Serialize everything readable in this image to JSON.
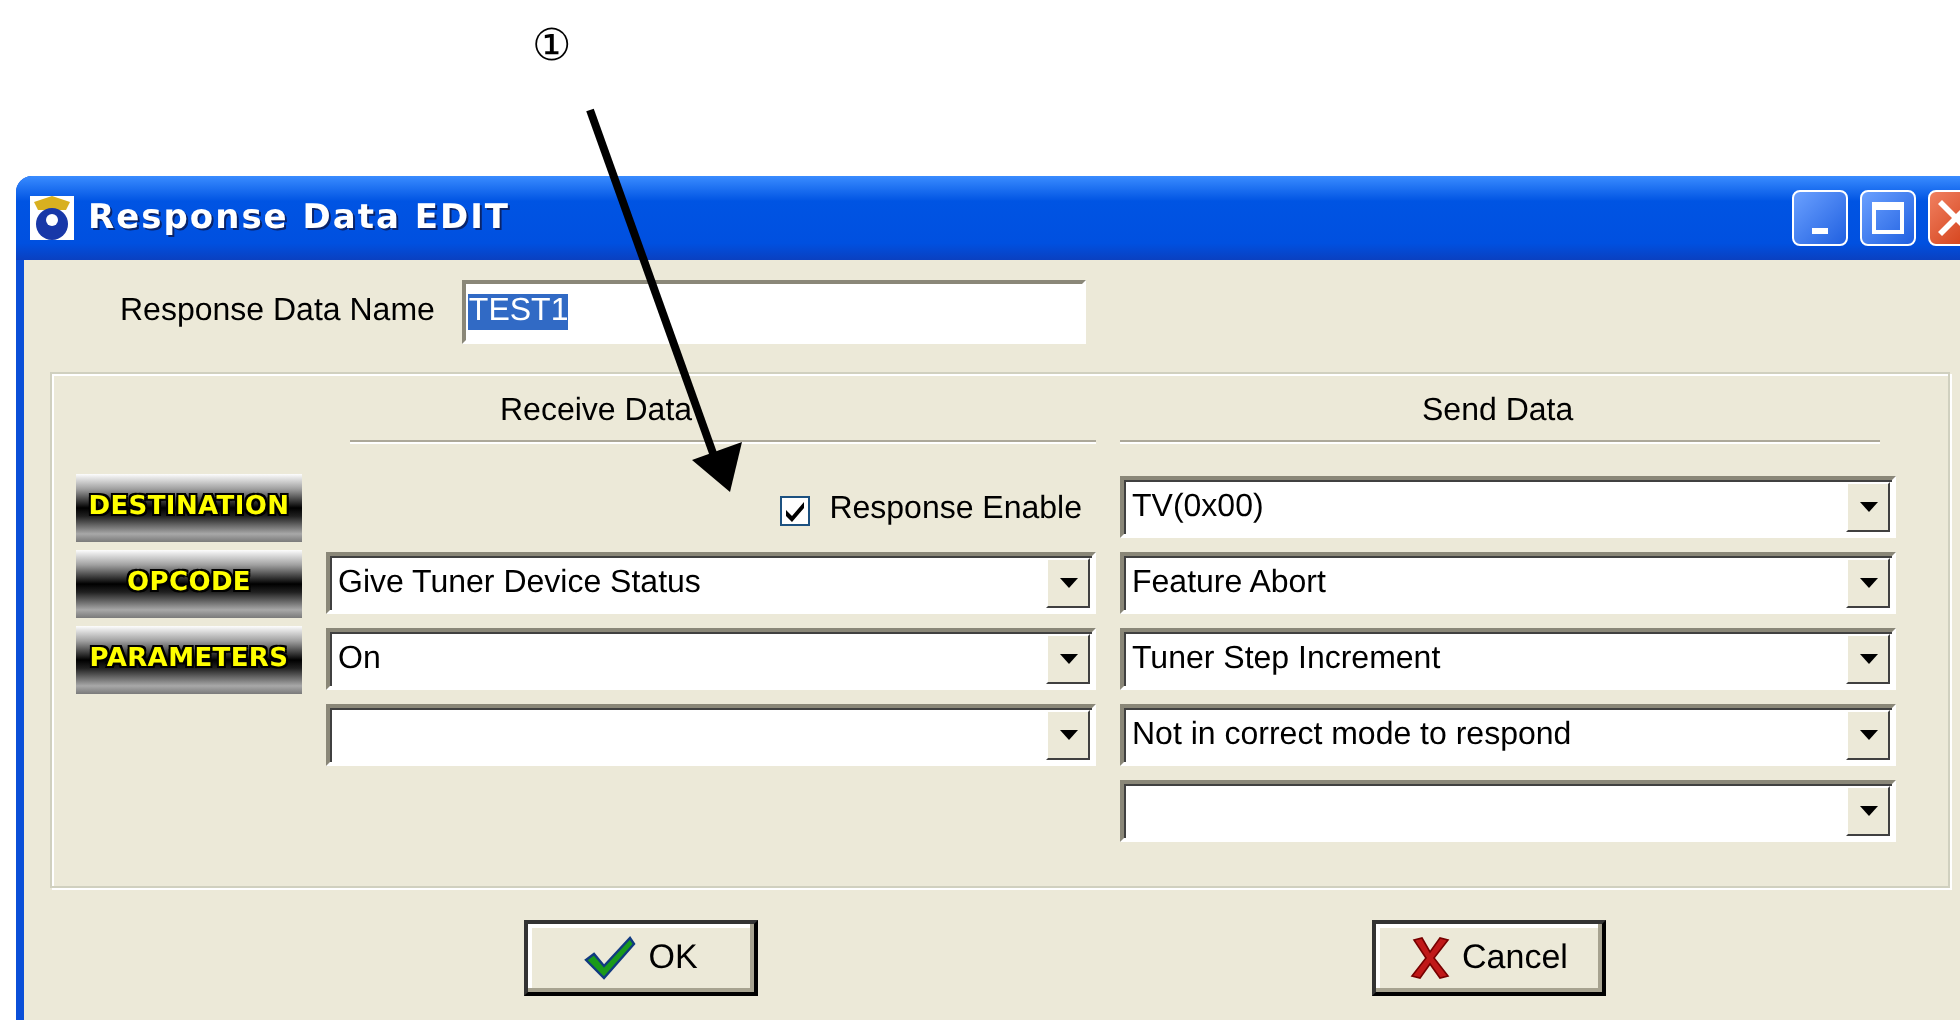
{
  "annotation": {
    "label": "①"
  },
  "window": {
    "title": "Response Data EDIT"
  },
  "name_field": {
    "label": "Response Data Name",
    "value": "TEST1",
    "text_selected": true
  },
  "headers": [
    {
      "label": "Receive Data"
    },
    {
      "label": "Send Data"
    }
  ],
  "response_enable": {
    "label": "Response Enable",
    "checked": true
  },
  "row_labels": [
    {
      "label": "DESTINATION"
    },
    {
      "label": "OPCODE"
    },
    {
      "label": "PARAMETERS"
    }
  ],
  "receive_fields": [
    {
      "kind": "dropdown",
      "value": "Give Tuner Device Status"
    },
    {
      "kind": "dropdown",
      "value": "On"
    },
    {
      "kind": "dropdown"
    }
  ],
  "send_fields": [
    {
      "kind": "dropdown",
      "value": "TV(0x00)"
    },
    {
      "kind": "dropdown",
      "value": "Feature Abort"
    },
    {
      "kind": "dropdown",
      "value": "Tuner Step Increment"
    },
    {
      "kind": "dropdown",
      "value": "Not in correct mode to respond"
    },
    {
      "kind": "dropdown"
    }
  ],
  "buttons": [
    {
      "label": "OK",
      "kind": "ok"
    },
    {
      "label": "Cancel",
      "kind": "cancel"
    }
  ]
}
